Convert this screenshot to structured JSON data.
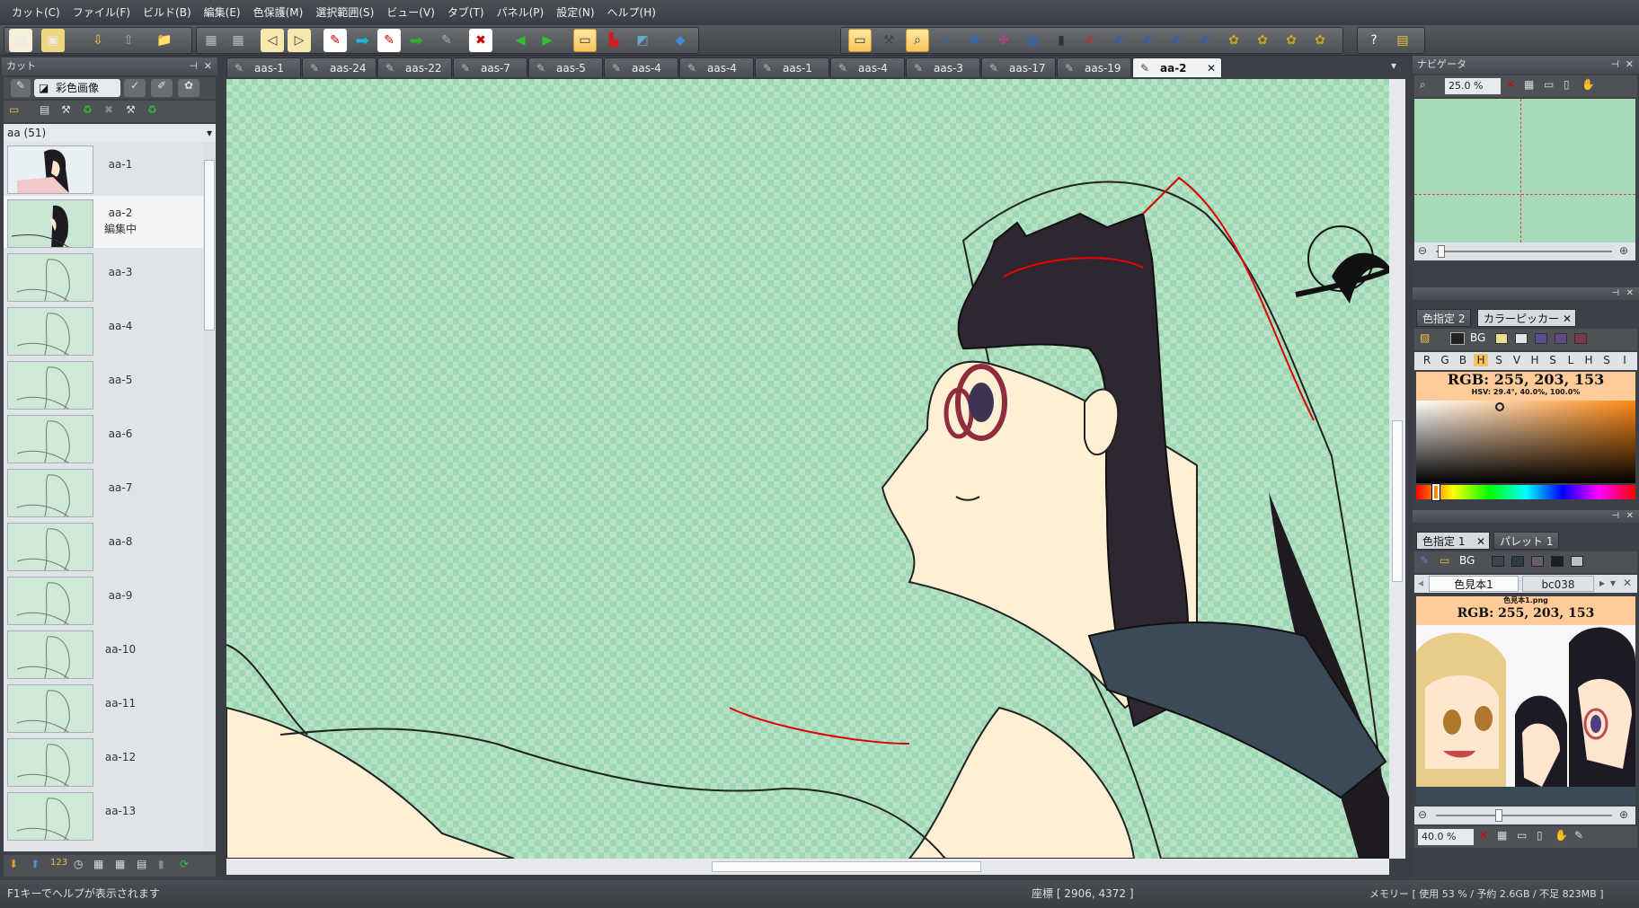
{
  "menu": [
    "カット(C)",
    "ファイル(F)",
    "ビルド(B)",
    "編集(E)",
    "色保護(M)",
    "選択範囲(S)",
    "ビュー(V)",
    "タブ(T)",
    "パネル(P)",
    "設定(N)",
    "ヘルプ(H)"
  ],
  "left_panel": {
    "title": "カット",
    "tab_label": "彩色画像",
    "dropdown": "aa (51)",
    "cuts": [
      {
        "label": "aa-1"
      },
      {
        "label": "aa-2",
        "sub": "編集中"
      },
      {
        "label": "aa-3"
      },
      {
        "label": "aa-4"
      },
      {
        "label": "aa-5"
      },
      {
        "label": "aa-6"
      },
      {
        "label": "aa-7"
      },
      {
        "label": "aa-8"
      },
      {
        "label": "aa-9"
      },
      {
        "label": "aa-10"
      },
      {
        "label": "aa-11"
      },
      {
        "label": "aa-12"
      },
      {
        "label": "aa-13"
      }
    ]
  },
  "doc_tabs": [
    "aas-1",
    "aas-24",
    "aas-22",
    "aas-7",
    "aas-5",
    "aas-4",
    "aas-4",
    "aas-1",
    "aas-4",
    "aas-3",
    "aas-17",
    "aas-19",
    "aa-2"
  ],
  "active_tab": "aa-2",
  "navigator": {
    "title": "ナビゲータ",
    "zoom": "25.0 %"
  },
  "color_picker": {
    "tabs": [
      "色指定 2",
      "カラーピッカー"
    ],
    "modes": [
      "R",
      "G",
      "B",
      "H",
      "S",
      "V",
      "H",
      "S",
      "L",
      "H",
      "S",
      "I"
    ],
    "bg_label": "BG",
    "rgb": "RGB: 255, 203, 153",
    "hsv": "HSV: 29.4°, 40.0%, 100.0%",
    "swatches": [
      "#e8e090",
      "#e0e6ec",
      "#5a4e8e",
      "#5e4a86",
      "#7a3a4c"
    ]
  },
  "color_sample": {
    "tabs": [
      "色指定 1",
      "パレット 1"
    ],
    "bg_label": "BG",
    "subtabs": [
      "色見本1",
      "bc038"
    ],
    "filename": "色見本1.png",
    "rgb": "RGB: 255, 203, 153",
    "zoom": "40.0 %",
    "swatches": [
      "#3b4452",
      "#2f3a48",
      "#6a5a70",
      "#1e1e22",
      "#b8c0c8"
    ]
  },
  "status": {
    "help": "F1キーでヘルプが表示されます",
    "coords": "座標 [ 2906, 4372 ]",
    "memory": "メモリー [ 使用 53 % / 予約 2.6GB / 不足 823MB ]"
  }
}
